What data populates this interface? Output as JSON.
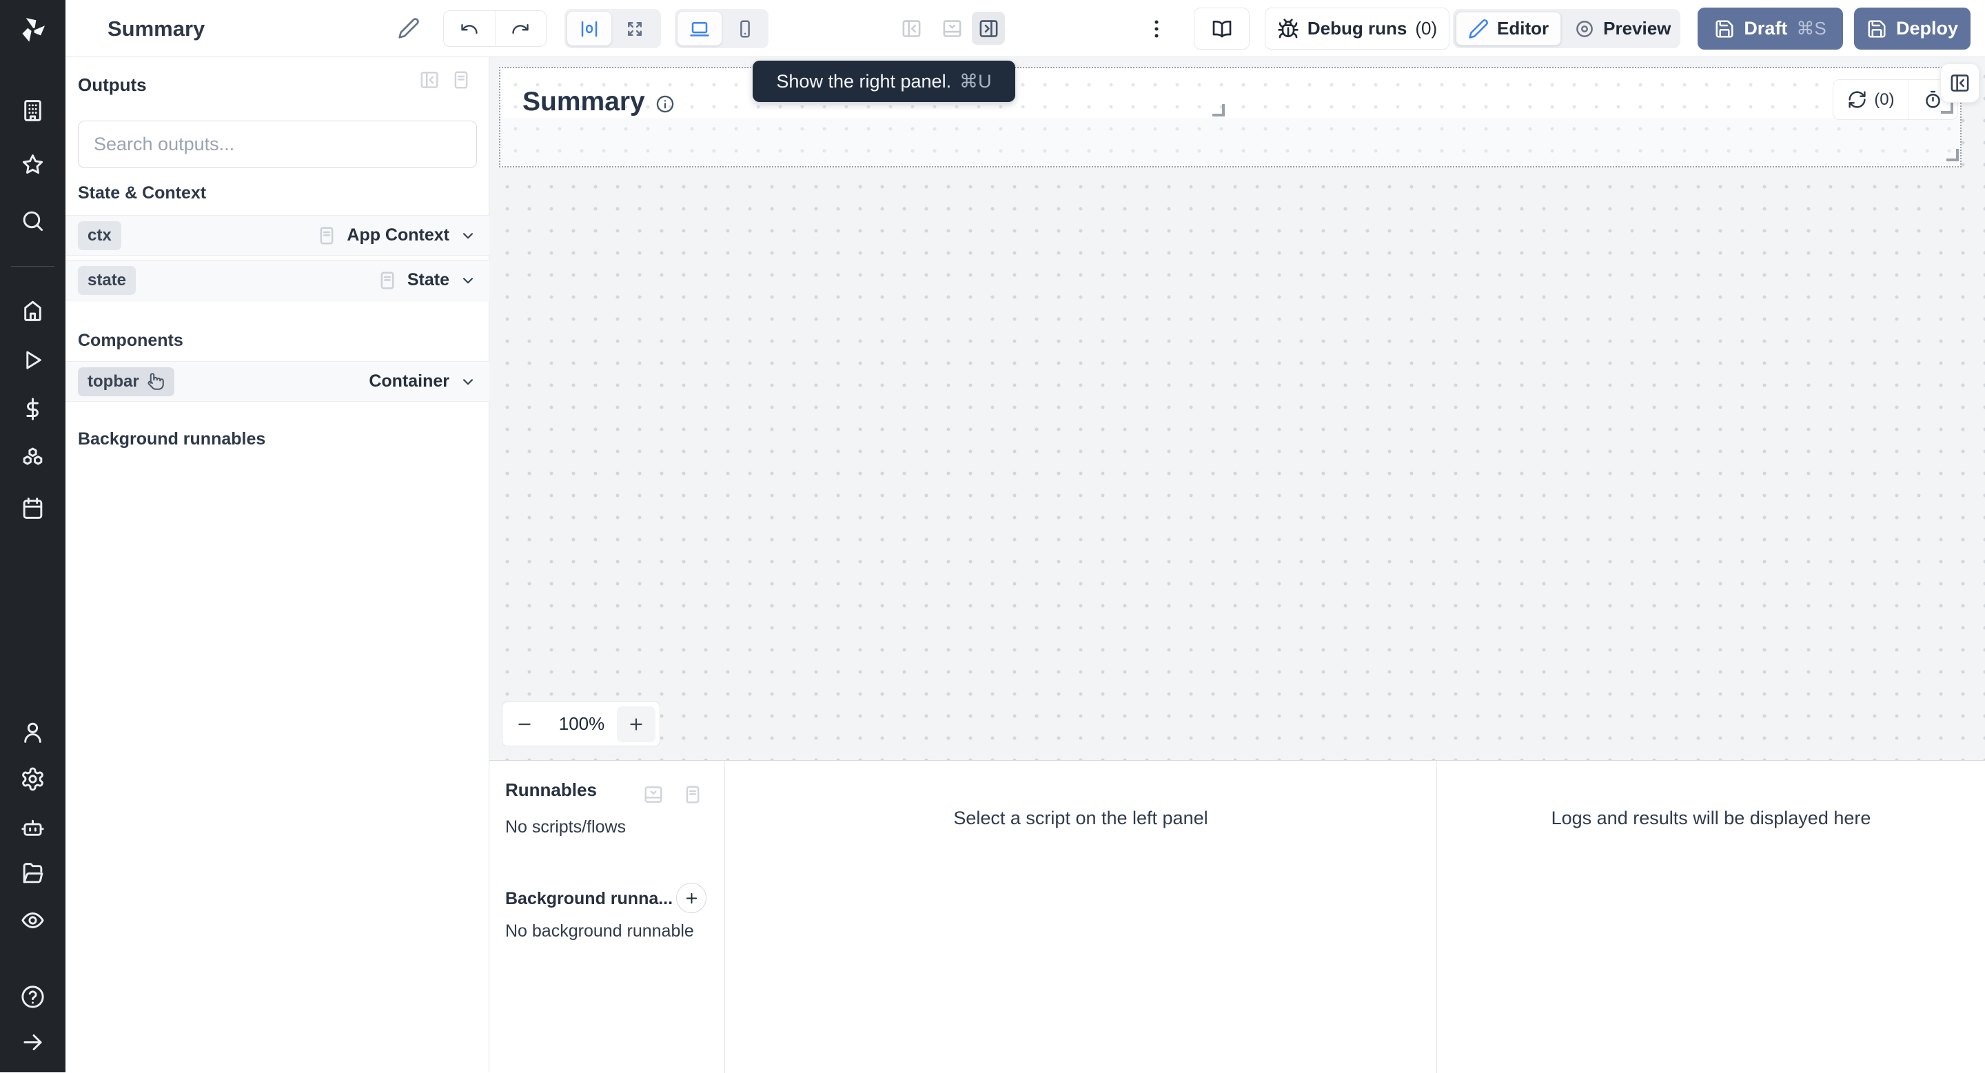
{
  "colors": {
    "accent": "#3b82f6",
    "primary_button": "#60739c",
    "sidebar": "#212529",
    "tooltip": "#202b3c"
  },
  "topbar": {
    "title": "Summary",
    "debug_runs": "Debug runs",
    "debug_count": "(0)",
    "editor": "Editor",
    "preview": "Preview",
    "draft": "Draft",
    "draft_shortcut": "⌘S",
    "deploy": "Deploy"
  },
  "outputs": {
    "title": "Outputs",
    "search_placeholder": "Search outputs...",
    "state_context_label": "State & Context",
    "components_label": "Components",
    "background_label": "Background runnables",
    "rows": [
      {
        "badge": "ctx",
        "type": "App Context"
      },
      {
        "badge": "state",
        "type": "State"
      },
      {
        "badge": "topbar",
        "type": "Container"
      }
    ]
  },
  "canvas": {
    "heading": "Summary",
    "refresh_count": "(0)",
    "zoom": "100%",
    "tooltip_text": "Show the right panel.",
    "tooltip_shortcut": "⌘U"
  },
  "bottom": {
    "runnables": "Runnables",
    "no_scripts": "No scripts/flows",
    "background_runnables": "Background runna...",
    "no_background": "No background runnable",
    "select_hint": "Select a script on the left panel",
    "logs_hint": "Logs and results will be displayed here"
  },
  "icons": [
    "windmill-logo",
    "building",
    "star",
    "search",
    "home",
    "play",
    "dollar",
    "boxes",
    "calendar",
    "user",
    "settings",
    "bot",
    "folder-open",
    "eye",
    "help",
    "arrow-right",
    "pencil",
    "undo",
    "redo",
    "align-center",
    "maximize",
    "laptop",
    "smartphone",
    "panel-left",
    "panel-bottom",
    "panel-right",
    "ellipsis-vertical",
    "book-open",
    "bug",
    "circle-dot",
    "save",
    "document",
    "chevron-down",
    "hand-pointer",
    "info",
    "refresh",
    "history",
    "plus",
    "minus"
  ]
}
